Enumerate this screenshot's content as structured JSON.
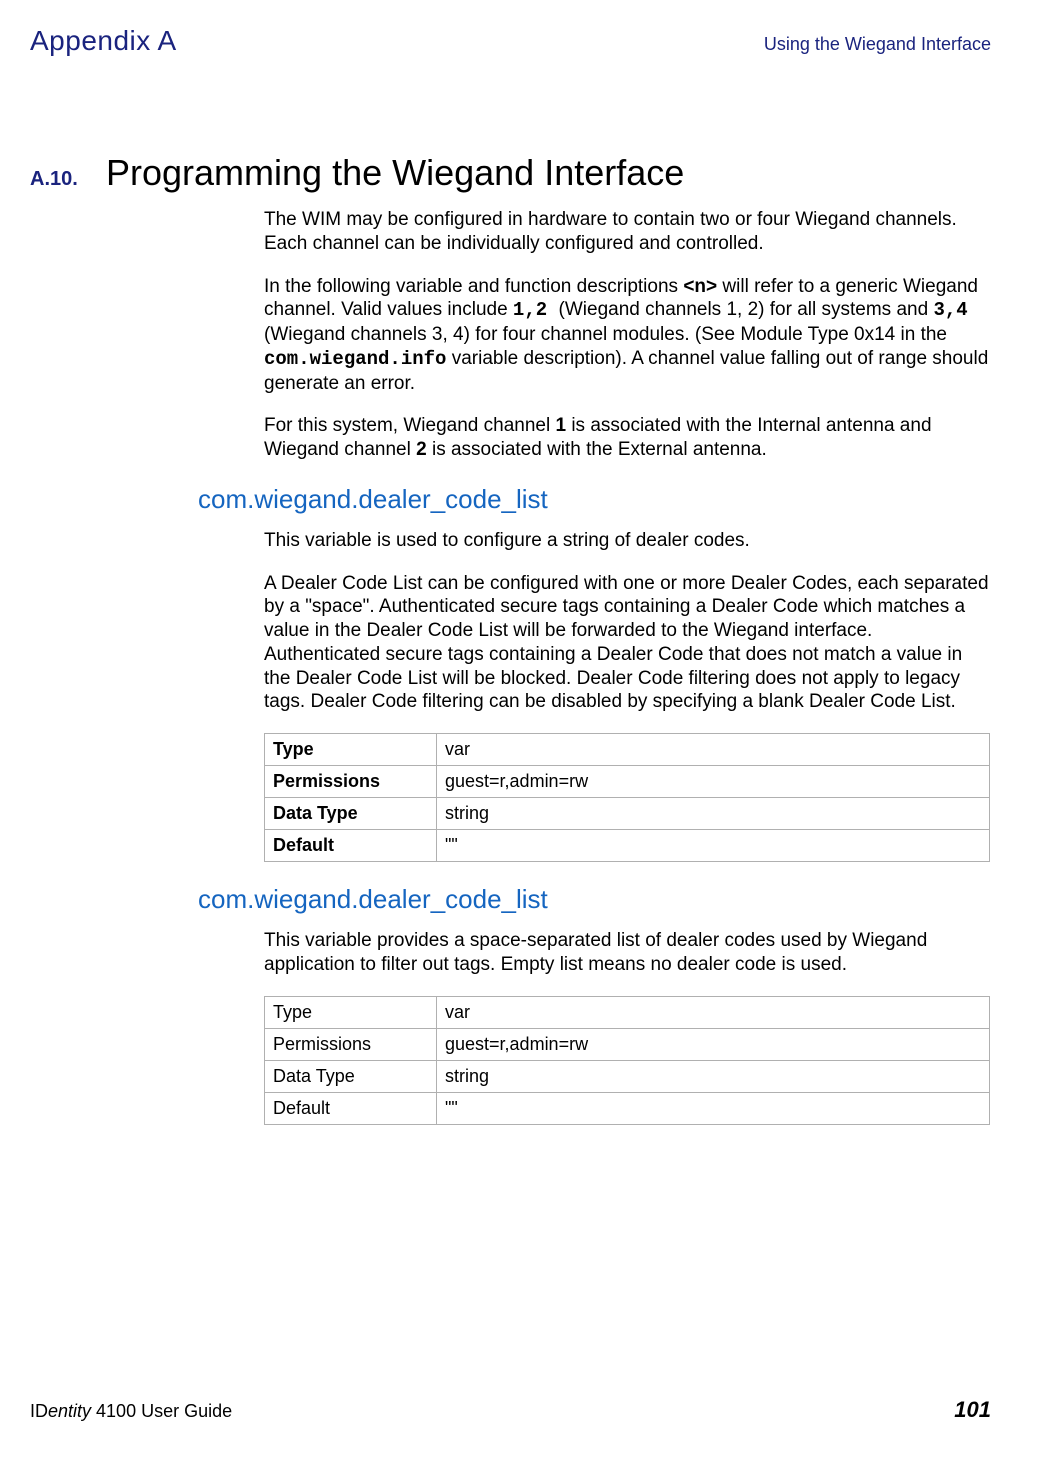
{
  "header": {
    "appendix": "Appendix A",
    "right": "Using the Wiegand Interface"
  },
  "section": {
    "number": "A.10.",
    "title": "Programming the Wiegand Interface",
    "p1": "The WIM may be configured in hardware to contain two or four Wiegand channels. Each channel can be individually configured and controlled.",
    "p2a": "In the following variable and function descriptions ",
    "p2b": "<n>",
    "p2c": " will refer to a generic Wiegand channel. Valid values include ",
    "p2d": "1,2 ",
    "p2e": " (Wiegand channels 1, 2) for all systems and ",
    "p2f": "3,4 ",
    "p2g": " (Wiegand channels 3, 4) for four channel modules. (See Module Type 0x14 in the ",
    "p2h": "com.wiegand.info",
    "p2i": " variable description). A channel value falling out of range should generate an error.",
    "p3a": "For this system, Wiegand channel ",
    "p3b": "1",
    "p3c": " is associated with the Internal antenna and Wiegand channel ",
    "p3d": "2",
    "p3e": " is associated with the External antenna."
  },
  "sub1": {
    "title": "com.wiegand.dealer_code_list",
    "p1": "This variable is used to configure a string of dealer codes.",
    "p2": "A Dealer Code List can be configured with one or more Dealer Codes, each separated by a \"space\". Authenticated secure tags containing a Dealer Code which matches a value in the Dealer Code List will be forwarded to the Wiegand interface. Authenticated secure tags containing a Dealer Code that does not match a value in the Dealer Code List will be blocked. Dealer Code filtering does not apply to legacy tags. Dealer Code filtering can be disabled by specifying a blank Dealer Code List.",
    "table": {
      "type_label": "Type",
      "type_val": "var",
      "perm_label": "Permissions",
      "perm_val": "guest=r,admin=rw",
      "dt_label": "Data Type",
      "dt_val": "string",
      "def_label": "Default",
      "def_val": "\"\""
    }
  },
  "sub2": {
    "title": "com.wiegand.dealer_code_list",
    "p1": "This variable provides a space-separated list of dealer codes used by Wiegand application to filter out tags. Empty list means no dealer code is used.",
    "table": {
      "type_label": "Type",
      "type_val": "var",
      "perm_label": "Permissions",
      "perm_val": "guest=r,admin=rw",
      "dt_label": "Data Type",
      "dt_val": "string",
      "def_label": "Default",
      "def_val": "\"\""
    }
  },
  "footer": {
    "left_prefix": "ID",
    "left_italic": "entity",
    "left_suffix": " 4100 User Guide",
    "page": "101"
  }
}
